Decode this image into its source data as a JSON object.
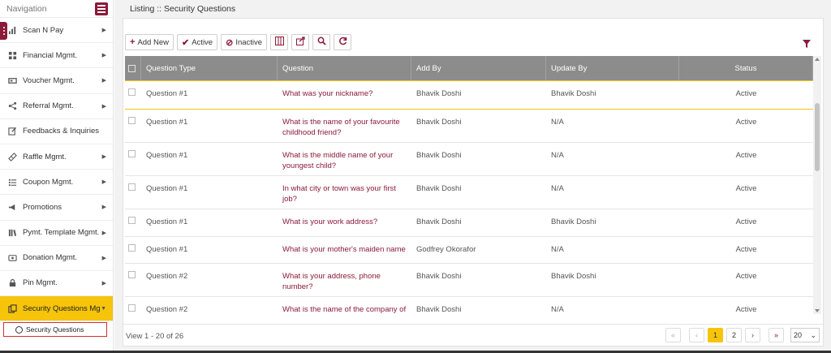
{
  "sidebar": {
    "header": "Navigation",
    "items": [
      {
        "label": "Scan N Pay",
        "icon": "bar-chart-icon"
      },
      {
        "label": "Financial Mgmt.",
        "icon": "grid-icon"
      },
      {
        "label": "Voucher Mgmt.",
        "icon": "voucher-icon"
      },
      {
        "label": "Referral Mgmt.",
        "icon": "share-icon"
      },
      {
        "label": "Feedbacks & Inquiries",
        "icon": "edit-icon"
      },
      {
        "label": "Raffle Mgmt.",
        "icon": "ticket-icon"
      },
      {
        "label": "Coupon Mgmt.",
        "icon": "list-icon"
      },
      {
        "label": "Promotions",
        "icon": "megaphone-icon"
      },
      {
        "label": "Pymt. Template Mgmt.",
        "icon": "books-icon"
      },
      {
        "label": "Donation Mgmt.",
        "icon": "donation-icon"
      },
      {
        "label": "Pin Mgmt.",
        "icon": "lock-icon"
      },
      {
        "label": "Security Questions Mgmt.",
        "icon": "copy-icon"
      }
    ],
    "active_sub": "Security Questions"
  },
  "page_title": "Listing :: Security Questions",
  "toolbar": {
    "add": "Add New",
    "active": "Active",
    "inactive": "Inactive"
  },
  "table": {
    "headers": [
      "Question Type",
      "Question",
      "Add By",
      "Update By",
      "Status"
    ],
    "rows": [
      {
        "type": "Question #1",
        "question": "What was your nickname?",
        "add_by": "Bhavik Doshi",
        "update_by": "Bhavik Doshi",
        "status": "Active"
      },
      {
        "type": "Question #1",
        "question": "What is the name of your favourite childhood friend?",
        "add_by": "Bhavik Doshi",
        "update_by": "N/A",
        "status": "Active"
      },
      {
        "type": "Question #1",
        "question": "What is the middle name of your youngest child?",
        "add_by": "Bhavik Doshi",
        "update_by": "N/A",
        "status": "Active"
      },
      {
        "type": "Question #1",
        "question": "In what city or town was your first job?",
        "add_by": "Bhavik Doshi",
        "update_by": "N/A",
        "status": "Active"
      },
      {
        "type": "Question #1",
        "question": "What is your work address?",
        "add_by": "Bhavik Doshi",
        "update_by": "Bhavik Doshi",
        "status": "Active"
      },
      {
        "type": "Question #1",
        "question": "What is your mother's maiden name",
        "add_by": "Godfrey Okorafor",
        "update_by": "N/A",
        "status": "Active"
      },
      {
        "type": "Question #2",
        "question": "What is your address, phone number?",
        "add_by": "Bhavik Doshi",
        "update_by": "Bhavik Doshi",
        "status": "Active"
      },
      {
        "type": "Question #2",
        "question": "What is the name of the company of",
        "add_by": "Bhavik Doshi",
        "update_by": "N/A",
        "status": "Active"
      }
    ]
  },
  "footer": {
    "view_info": "View 1 - 20 of 26",
    "pages": [
      "1",
      "2"
    ],
    "current_page": "1",
    "page_size": "20"
  },
  "colors": {
    "brand": "#8a1a3a",
    "accent": "#f6c40b",
    "header_bg": "#8c8c8c"
  }
}
